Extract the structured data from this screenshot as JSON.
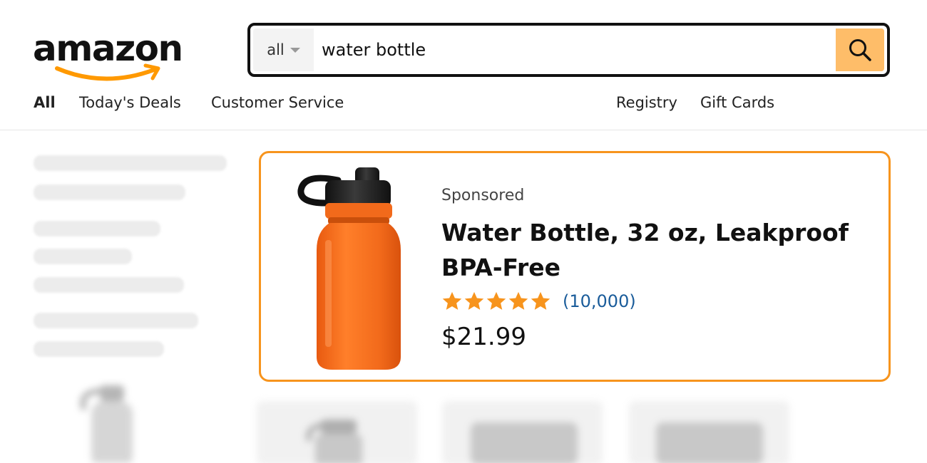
{
  "header": {
    "logo_text": "amazon",
    "search": {
      "category": "all",
      "query": "water bottle",
      "button_icon": "search-icon"
    },
    "nav": {
      "all": "All",
      "deals": "Today's Deals",
      "customer_service": "Customer Service",
      "registry": "Registry",
      "gift_cards": "Gift Cards"
    }
  },
  "main": {
    "sponsored_product": {
      "label": "Sponsored",
      "title": "Water Bottle, 32 oz, Leakproof BPA-Free",
      "rating_stars": 5,
      "reviews": "(10,000)",
      "price": "$21.99",
      "image_icon": "water-bottle-image"
    }
  },
  "colors": {
    "accent": "#f7941d",
    "search_button": "#febd69",
    "link": "#1a5c9a",
    "bottle": "#f26a1b"
  }
}
